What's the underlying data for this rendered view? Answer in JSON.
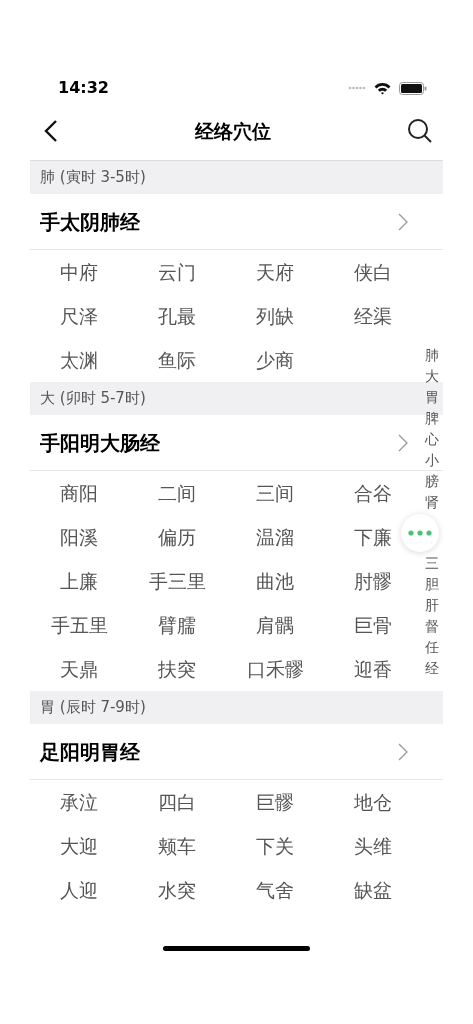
{
  "status_bar": {
    "time": "14:32"
  },
  "nav": {
    "title": "经络穴位"
  },
  "sections": [
    {
      "header": "肺 (寅时 3-5时)",
      "meridian": "手太阴肺经",
      "points": [
        "中府",
        "云门",
        "天府",
        "侠白",
        "尺泽",
        "孔最",
        "列缺",
        "经渠",
        "太渊",
        "鱼际",
        "少商"
      ]
    },
    {
      "header": "大 (卯时 5-7时)",
      "meridian": "手阳明大肠经",
      "points": [
        "商阳",
        "二间",
        "三间",
        "合谷",
        "阳溪",
        "偏历",
        "温溜",
        "下廉",
        "上廉",
        "手三里",
        "曲池",
        "肘髎",
        "手五里",
        "臂臑",
        "肩髃",
        "巨骨",
        "天鼎",
        "扶突",
        "口禾髎",
        "迎香"
      ]
    },
    {
      "header": "胃 (辰时 7-9时)",
      "meridian": "足阳明胃经",
      "points": [
        "承泣",
        "四白",
        "巨髎",
        "地仓",
        "大迎",
        "颊车",
        "下关",
        "头维",
        "人迎",
        "水突",
        "气舍",
        "缺盆"
      ]
    }
  ],
  "index_top": [
    "肺",
    "大",
    "胃",
    "脾",
    "心",
    "小",
    "膀",
    "肾"
  ],
  "index_bottom": [
    "三",
    "胆",
    "肝",
    "督",
    "任",
    "经"
  ]
}
